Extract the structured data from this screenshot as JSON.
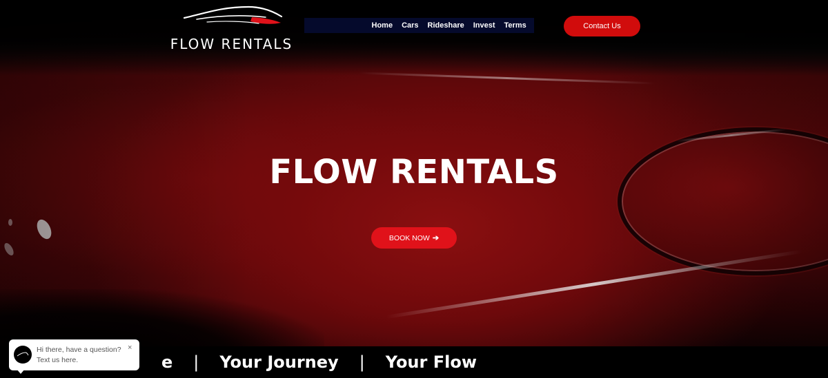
{
  "brand": {
    "logo_text": "FLOW RENTALS"
  },
  "nav": {
    "items": [
      {
        "label": "Home"
      },
      {
        "label": "Cars"
      },
      {
        "label": "Rideshare"
      },
      {
        "label": "Invest"
      },
      {
        "label": "Terms"
      }
    ],
    "contact_label": "Contact Us"
  },
  "hero": {
    "title": "FLOW RENTALS",
    "book_label": "BOOK NOW",
    "book_icon": "arrow-right-icon"
  },
  "marquee": {
    "items": [
      "e",
      "Your Journey",
      "Your Flow"
    ],
    "separator": "|"
  },
  "chat": {
    "line1": "Hi there, have a question?",
    "line2": "Text us here.",
    "close": "×"
  },
  "colors": {
    "accent": "#d10c0c",
    "nav_bg": "#050a2c",
    "background": "#000000"
  }
}
